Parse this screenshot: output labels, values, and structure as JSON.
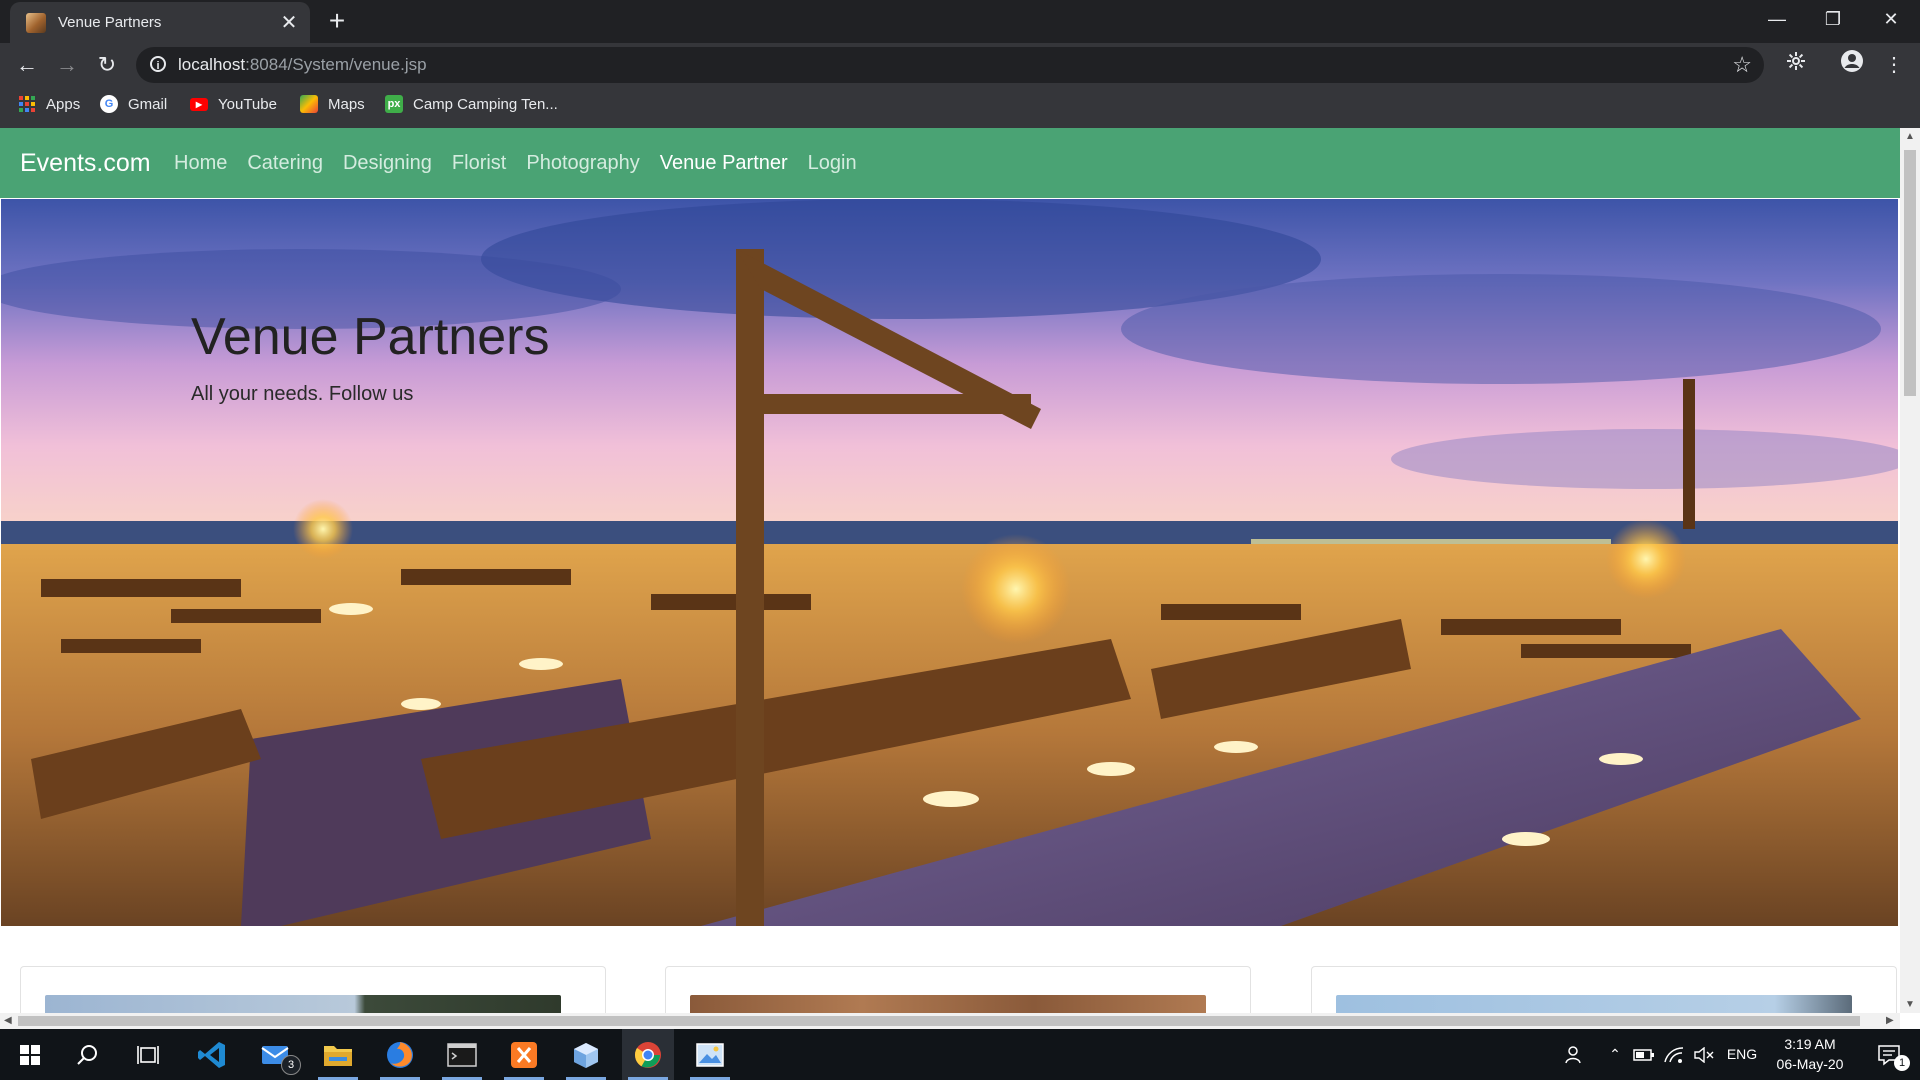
{
  "browser": {
    "tab_title": "Venue Partners",
    "tab_close": "✕",
    "new_tab": "+",
    "url_host": "localhost",
    "url_rest": ":8084/System/venue.jsp",
    "window_controls": {
      "minimize": "—",
      "restore": "❐",
      "close": "✕"
    },
    "nav": {
      "back": "←",
      "forward": "→",
      "reload": "↻"
    }
  },
  "bookmarks": [
    {
      "label": "Apps",
      "icon": "apps-grid-icon"
    },
    {
      "label": "Gmail",
      "icon": "google-icon"
    },
    {
      "label": "YouTube",
      "icon": "youtube-icon"
    },
    {
      "label": "Maps",
      "icon": "maps-icon"
    },
    {
      "label": "Camp Camping Ten...",
      "icon": "px-icon"
    }
  ],
  "site": {
    "brand": "Events.com",
    "nav_links": [
      "Home",
      "Catering",
      "Designing",
      "Florist",
      "Photography",
      "Venue Partner",
      "Login"
    ],
    "active_link": "Venue Partner",
    "accent_color": "#4aa374"
  },
  "hero": {
    "title": "Venue Partners",
    "subtitle": "All your needs. Follow us"
  },
  "taskbar": {
    "mail_badge": "3",
    "language": "ENG",
    "time": "3:19 AM",
    "date": "06-May-20",
    "notification_count": "1"
  }
}
